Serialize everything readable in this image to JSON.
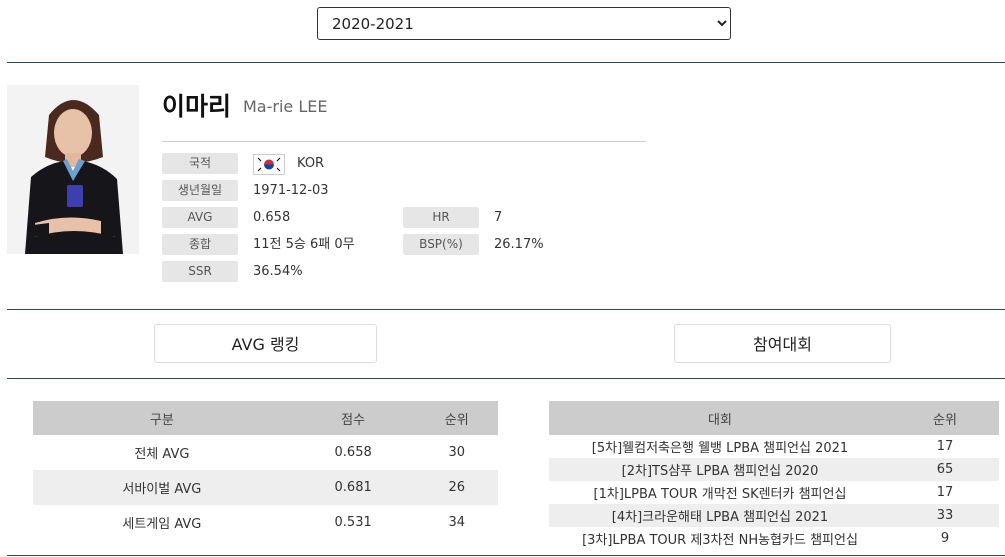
{
  "season": {
    "selected": "2020-2021"
  },
  "profile": {
    "name_ko": "이마리",
    "name_en": "Ma-rie LEE",
    "photo_icon": "player-photo",
    "fields": {
      "nationality_label": "국적",
      "nationality_value": "KOR",
      "flag_icon": "korea-flag-icon",
      "birth_label": "생년월일",
      "birth_value": "1971-12-03",
      "avg_label": "AVG",
      "avg_value": "0.658",
      "hr_label": "HR",
      "hr_value": "7",
      "record_label": "종합",
      "record_value": "11전 5승 6패 0무",
      "bsp_label": "BSP(%)",
      "bsp_value": "26.17%",
      "ssr_label": "SSR",
      "ssr_value": "36.54%"
    }
  },
  "tabs": {
    "avg_ranking": "AVG 랭킹",
    "tournaments": "참여대회"
  },
  "avg_table": {
    "headers": [
      "구분",
      "점수",
      "순위"
    ],
    "rows": [
      [
        "전체 AVG",
        "0.658",
        "30"
      ],
      [
        "서바이벌 AVG",
        "0.681",
        "26"
      ],
      [
        "세트게임 AVG",
        "0.531",
        "34"
      ]
    ]
  },
  "tour_table": {
    "headers": [
      "대회",
      "순위"
    ],
    "rows": [
      [
        "[5차]웰컴저축은행 웰뱅 LPBA 챔피언십 2021",
        "17"
      ],
      [
        "[2차]TS샴푸 LPBA 챔피언십 2020",
        "65"
      ],
      [
        "[1차]LPBA TOUR 개막전 SK렌터카 챔피언십",
        "17"
      ],
      [
        "[4차]크라운해태 LPBA 챔피언십 2021",
        "33"
      ],
      [
        "[3차]LPBA TOUR 제3차전 NH농협카드 챔피언십",
        "9"
      ]
    ]
  }
}
